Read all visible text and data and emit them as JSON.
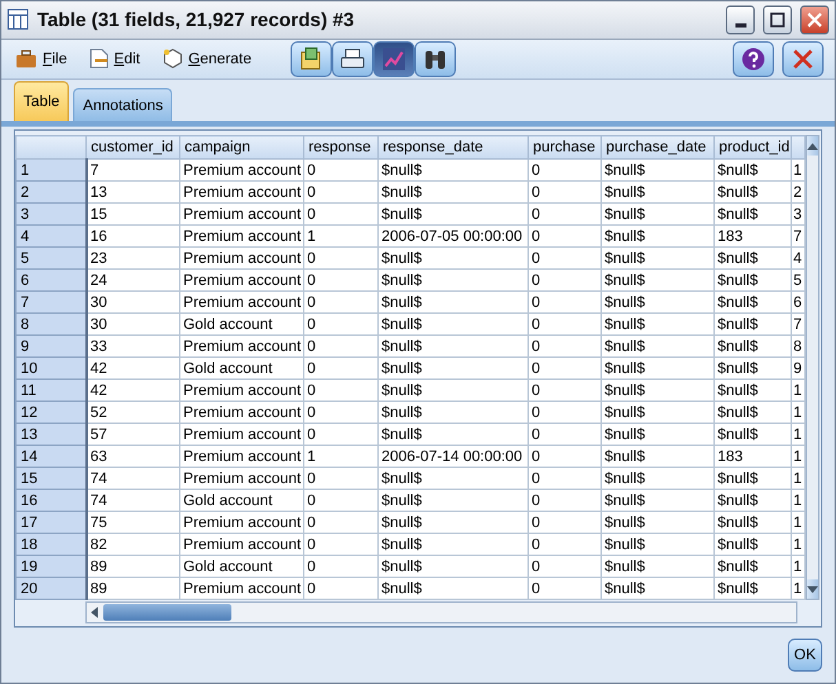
{
  "window": {
    "title": "Table (31 fields, 21,927 records) #3"
  },
  "menu": [
    {
      "label": "File",
      "kind": "file"
    },
    {
      "label": "Edit",
      "kind": "edit"
    },
    {
      "label": "Generate",
      "kind": "generate"
    }
  ],
  "toolbar": [
    {
      "kind": "export",
      "selected": false
    },
    {
      "kind": "print",
      "selected": false
    },
    {
      "kind": "chart",
      "selected": true
    },
    {
      "kind": "find",
      "selected": false
    }
  ],
  "tabs": [
    {
      "label": "Table",
      "selected": true
    },
    {
      "label": "Annotations",
      "selected": false
    }
  ],
  "table": {
    "columns": [
      "customer_id",
      "campaign",
      "response",
      "response_date",
      "purchase",
      "purchase_date",
      "product_id",
      ""
    ],
    "rows": [
      {
        "number": "1",
        "cells": [
          "7",
          "Premium account",
          "0",
          "$null$",
          "0",
          "$null$",
          "$null$",
          "1"
        ]
      },
      {
        "number": "2",
        "cells": [
          "13",
          "Premium account",
          "0",
          "$null$",
          "0",
          "$null$",
          "$null$",
          "2"
        ]
      },
      {
        "number": "3",
        "cells": [
          "15",
          "Premium account",
          "0",
          "$null$",
          "0",
          "$null$",
          "$null$",
          "3"
        ]
      },
      {
        "number": "4",
        "cells": [
          "16",
          "Premium account",
          "1",
          "2006-07-05 00:00:00",
          "0",
          "$null$",
          "183",
          "7"
        ]
      },
      {
        "number": "5",
        "cells": [
          "23",
          "Premium account",
          "0",
          "$null$",
          "0",
          "$null$",
          "$null$",
          "4"
        ]
      },
      {
        "number": "6",
        "cells": [
          "24",
          "Premium account",
          "0",
          "$null$",
          "0",
          "$null$",
          "$null$",
          "5"
        ]
      },
      {
        "number": "7",
        "cells": [
          "30",
          "Premium account",
          "0",
          "$null$",
          "0",
          "$null$",
          "$null$",
          "6"
        ]
      },
      {
        "number": "8",
        "cells": [
          "30",
          "Gold account",
          "0",
          "$null$",
          "0",
          "$null$",
          "$null$",
          "7"
        ]
      },
      {
        "number": "9",
        "cells": [
          "33",
          "Premium account",
          "0",
          "$null$",
          "0",
          "$null$",
          "$null$",
          "8"
        ]
      },
      {
        "number": "10",
        "cells": [
          "42",
          "Gold account",
          "0",
          "$null$",
          "0",
          "$null$",
          "$null$",
          "9"
        ]
      },
      {
        "number": "11",
        "cells": [
          "42",
          "Premium account",
          "0",
          "$null$",
          "0",
          "$null$",
          "$null$",
          "1"
        ]
      },
      {
        "number": "12",
        "cells": [
          "52",
          "Premium account",
          "0",
          "$null$",
          "0",
          "$null$",
          "$null$",
          "1"
        ]
      },
      {
        "number": "13",
        "cells": [
          "57",
          "Premium account",
          "0",
          "$null$",
          "0",
          "$null$",
          "$null$",
          "1"
        ]
      },
      {
        "number": "14",
        "cells": [
          "63",
          "Premium account",
          "1",
          "2006-07-14 00:00:00",
          "0",
          "$null$",
          "183",
          "1"
        ]
      },
      {
        "number": "15",
        "cells": [
          "74",
          "Premium account",
          "0",
          "$null$",
          "0",
          "$null$",
          "$null$",
          "1"
        ]
      },
      {
        "number": "16",
        "cells": [
          "74",
          "Gold account",
          "0",
          "$null$",
          "0",
          "$null$",
          "$null$",
          "1"
        ]
      },
      {
        "number": "17",
        "cells": [
          "75",
          "Premium account",
          "0",
          "$null$",
          "0",
          "$null$",
          "$null$",
          "1"
        ]
      },
      {
        "number": "18",
        "cells": [
          "82",
          "Premium account",
          "0",
          "$null$",
          "0",
          "$null$",
          "$null$",
          "1"
        ]
      },
      {
        "number": "19",
        "cells": [
          "89",
          "Gold account",
          "0",
          "$null$",
          "0",
          "$null$",
          "$null$",
          "1"
        ]
      },
      {
        "number": "20",
        "cells": [
          "89",
          "Premium account",
          "0",
          "$null$",
          "0",
          "$null$",
          "$null$",
          "1"
        ]
      }
    ]
  },
  "buttons": [
    "OK"
  ]
}
